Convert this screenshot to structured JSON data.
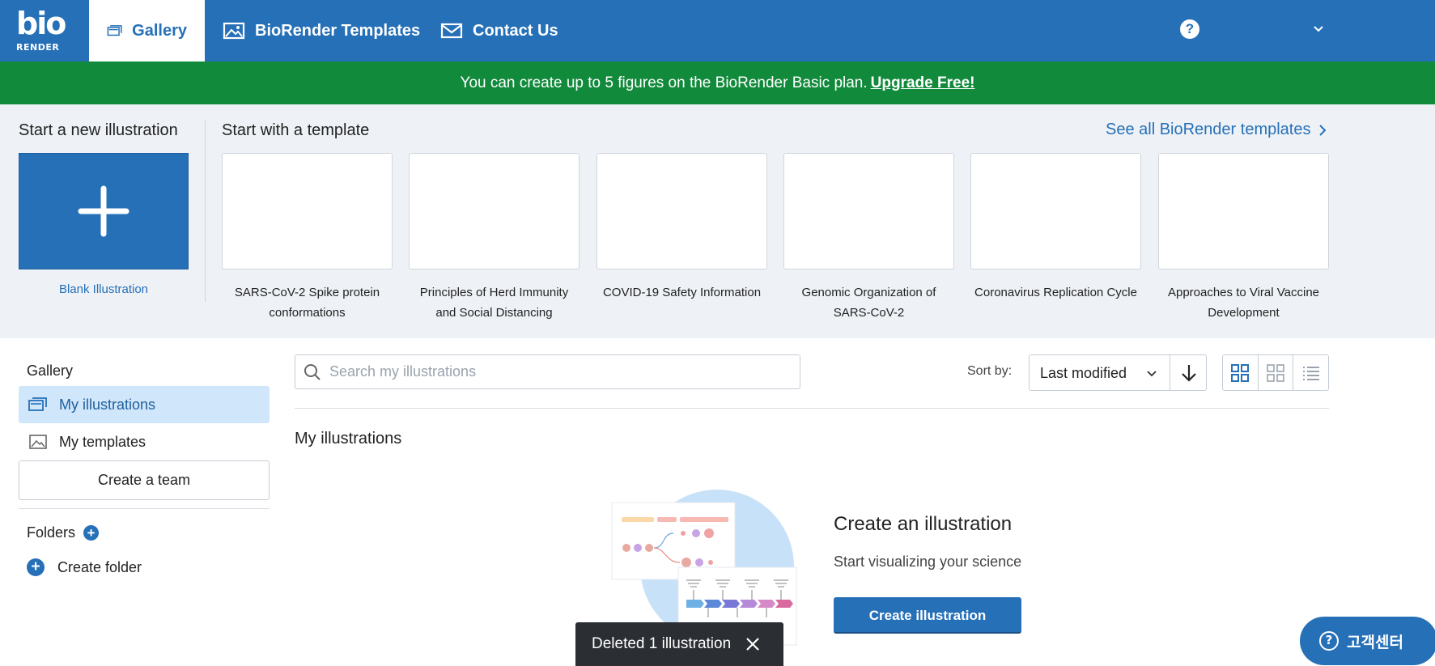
{
  "logo": {
    "line1": "bio",
    "line2": "RENDER"
  },
  "nav": {
    "tabs": [
      {
        "label": "Gallery",
        "icon": "gallery-icon",
        "active": true
      },
      {
        "label": "BioRender Templates",
        "icon": "image-icon",
        "active": false
      },
      {
        "label": "Contact Us",
        "icon": "mail-icon",
        "active": false
      }
    ],
    "help_glyph": "?"
  },
  "banner": {
    "text": "You can create up to 5 figures on the BioRender Basic plan.",
    "link": "Upgrade Free!"
  },
  "templates_strip": {
    "new_heading": "Start a new illustration",
    "blank_label": "Blank Illustration",
    "template_heading": "Start with a template",
    "see_all": "See all BioRender templates",
    "templates": [
      {
        "title": "SARS-CoV-2 Spike protein conformations"
      },
      {
        "title": "Principles of Herd Immunity and Social Distancing"
      },
      {
        "title": "COVID-19 Safety Information"
      },
      {
        "title": "Genomic Organization of SARS-CoV-2"
      },
      {
        "title": "Coronavirus Replication Cycle"
      },
      {
        "title": "Approaches to Viral Vaccine Development"
      }
    ]
  },
  "sidebar": {
    "heading": "Gallery",
    "items": [
      {
        "label": "My illustrations",
        "active": true
      },
      {
        "label": "My templates",
        "active": false
      }
    ],
    "create_team": "Create a team",
    "folders_heading": "Folders",
    "create_folder": "Create folder"
  },
  "toolbar": {
    "search_placeholder": "Search my illustrations",
    "sort_label": "Sort by:",
    "sort_value": "Last modified",
    "view_modes": [
      "large-grid",
      "small-grid",
      "list"
    ],
    "active_view": "large-grid"
  },
  "main": {
    "heading": "My illustrations",
    "empty_title": "Create an illustration",
    "empty_subtitle": "Start visualizing your science",
    "empty_button": "Create illustration"
  },
  "toast": {
    "message": "Deleted 1 illustration"
  },
  "help_widget": {
    "label": "고객센터"
  },
  "colors": {
    "brand_blue": "#2670b8",
    "banner_green": "#128a3b",
    "strip_bg": "#eef2f6",
    "active_item_bg": "#cfe6fb"
  }
}
